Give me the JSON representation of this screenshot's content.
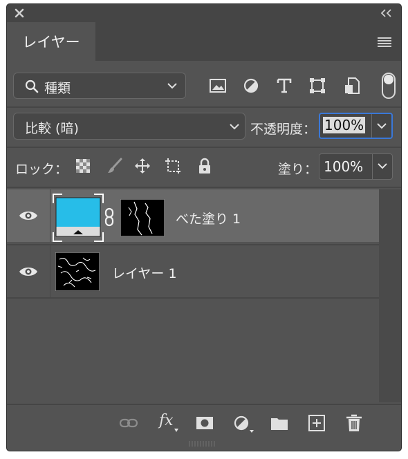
{
  "panel": {
    "tab_label": "レイヤー"
  },
  "filter": {
    "kind_label": "種類",
    "icons": [
      "image-filter-icon",
      "adjustment-filter-icon",
      "type-filter-icon",
      "shape-filter-icon",
      "smart-object-filter-icon"
    ]
  },
  "blend": {
    "mode_label": "比較 (暗)",
    "opacity_label": "不透明度：",
    "opacity_value": "100%"
  },
  "lock": {
    "label": "ロック：",
    "fill_label": "塗り：",
    "fill_value": "100%"
  },
  "layers": [
    {
      "name": "べた塗り 1",
      "selected": true,
      "fill_color": "#27bde8"
    },
    {
      "name": "レイヤー 1",
      "selected": false
    }
  ],
  "bottom_icons": [
    "link-layers-icon",
    "fx-icon",
    "mask-icon",
    "adjustment-layer-icon",
    "group-folder-icon",
    "new-layer-icon",
    "trash-icon"
  ],
  "bottom": {
    "fx_label": "fx"
  }
}
